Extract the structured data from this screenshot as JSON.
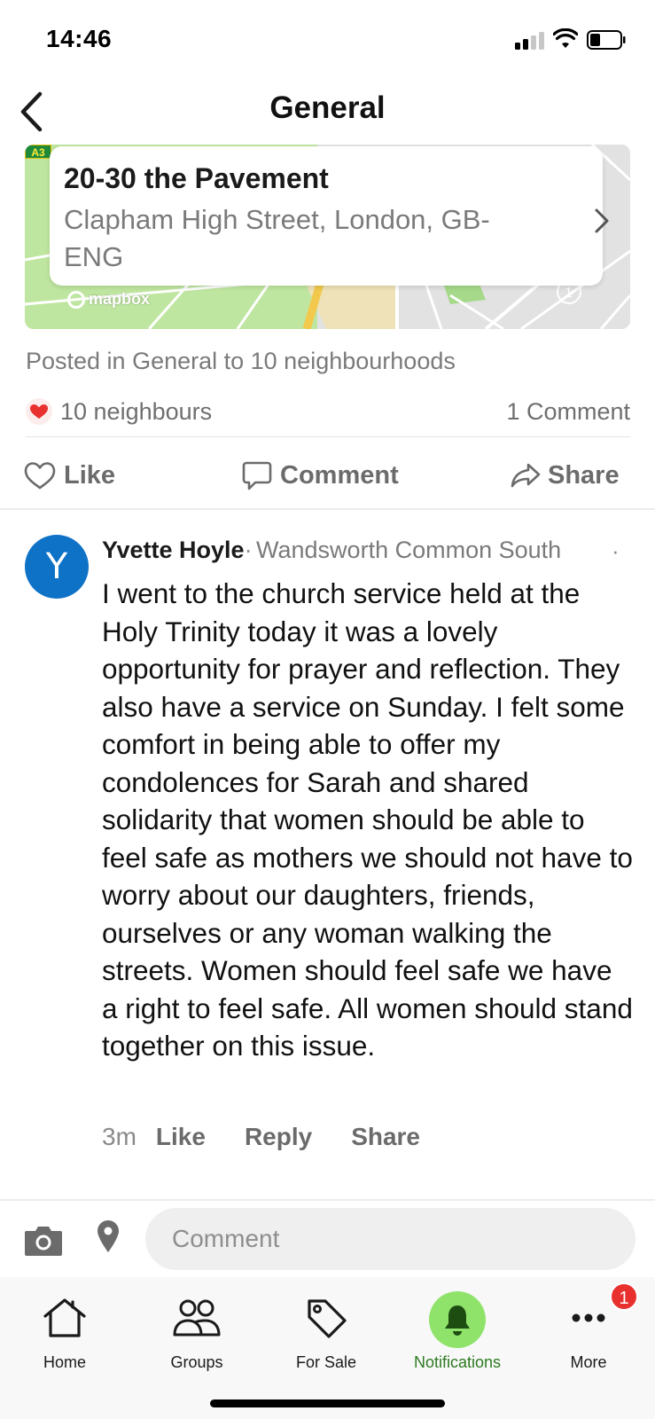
{
  "status_bar": {
    "time": "14:46"
  },
  "header": {
    "title": "General"
  },
  "map": {
    "road_badge": "A3",
    "location_title": "20-30 the Pavement",
    "location_subtitle": "Clapham High Street, London, GB-ENG",
    "attribution": "mapbox"
  },
  "post": {
    "posted_in": "Posted in General to 10 neighbourhoods",
    "reactions_count": "10 neighbours",
    "comments_count": "1 Comment",
    "actions": {
      "like": "Like",
      "comment": "Comment",
      "share": "Share"
    }
  },
  "comment": {
    "avatar_letter": "Y",
    "author": "Yvette Hoyle",
    "separator": "·",
    "neighbourhood": "Wandsworth Common South",
    "more": "·",
    "body": "I went to the church service held at the Holy Trinity today it was a lovely opportunity for  prayer and reflection. They also have a service on Sunday.  I felt some comfort in being able to offer my condolences for Sarah and shared solidarity that women should be able to feel safe as mothers we should not have to worry about our daughters, friends, ourselves or any woman walking the streets.  Women should feel safe we have a right to feel safe. All women should stand together on this issue.",
    "time": "3m",
    "like": "Like",
    "reply": "Reply",
    "share": "Share"
  },
  "input": {
    "placeholder": "Comment",
    "value": ""
  },
  "nav": {
    "items": [
      {
        "label": "Home",
        "icon": "home-icon"
      },
      {
        "label": "Groups",
        "icon": "groups-icon"
      },
      {
        "label": "For Sale",
        "icon": "tag-icon"
      },
      {
        "label": "Notifications",
        "icon": "bell-icon",
        "active": true
      },
      {
        "label": "More",
        "icon": "more-icon"
      }
    ],
    "more_badge": "1"
  },
  "colors": {
    "accent_green": "#8fe36b",
    "active_label": "#2b7a1f",
    "badge_red": "#e8302e",
    "heart_red": "#e8302e",
    "avatar_blue": "#0e72c7"
  }
}
